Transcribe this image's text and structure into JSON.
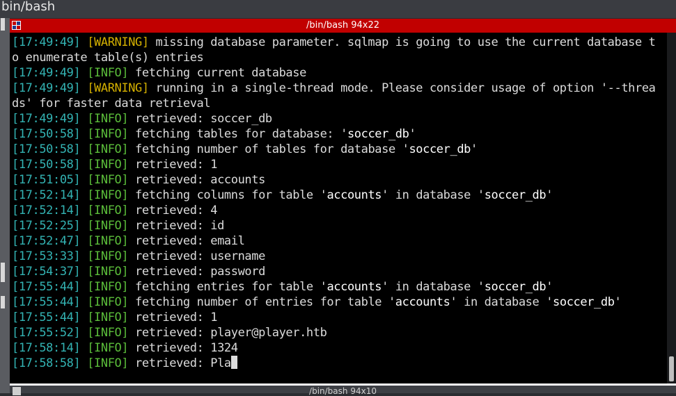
{
  "window": {
    "title": "bin/bash"
  },
  "pane": {
    "title": "/bin/bash 94x22"
  },
  "bottom_pane": {
    "title": "/bin/bash 94x10"
  },
  "terminal": {
    "lines": [
      {
        "ts": "[17:49:49]",
        "level": "[WARNING]",
        "level_kind": "warn",
        "text": " missing database parameter. sqlmap is going to use the current database t"
      },
      {
        "ts": "",
        "level": "",
        "level_kind": "none",
        "text": "o enumerate table(s) entries"
      },
      {
        "ts": "[17:49:49]",
        "level": "[INFO]",
        "level_kind": "info",
        "text": " fetching current database"
      },
      {
        "ts": "[17:49:49]",
        "level": "[WARNING]",
        "level_kind": "warn",
        "text": " running in a single-thread mode. Please consider usage of option '--threa"
      },
      {
        "ts": "",
        "level": "",
        "level_kind": "none",
        "text": "ds' for faster data retrieval"
      },
      {
        "ts": "[17:49:49]",
        "level": "[INFO]",
        "level_kind": "info",
        "text": " retrieved: soccer_db"
      },
      {
        "ts": "[17:50:58]",
        "level": "[INFO]",
        "level_kind": "info",
        "text": " fetching tables for database: 'soccer_db'"
      },
      {
        "ts": "[17:50:58]",
        "level": "[INFO]",
        "level_kind": "info",
        "text": " fetching number of tables for database 'soccer_db'"
      },
      {
        "ts": "[17:50:58]",
        "level": "[INFO]",
        "level_kind": "info",
        "text": " retrieved: 1"
      },
      {
        "ts": "[17:51:05]",
        "level": "[INFO]",
        "level_kind": "info",
        "text": " retrieved: accounts"
      },
      {
        "ts": "[17:52:14]",
        "level": "[INFO]",
        "level_kind": "info",
        "text": " fetching columns for table 'accounts' in database 'soccer_db'"
      },
      {
        "ts": "[17:52:14]",
        "level": "[INFO]",
        "level_kind": "info",
        "text": " retrieved: 4"
      },
      {
        "ts": "[17:52:25]",
        "level": "[INFO]",
        "level_kind": "info",
        "text": " retrieved: id"
      },
      {
        "ts": "[17:52:47]",
        "level": "[INFO]",
        "level_kind": "info",
        "text": " retrieved: email"
      },
      {
        "ts": "[17:53:33]",
        "level": "[INFO]",
        "level_kind": "info",
        "text": " retrieved: username"
      },
      {
        "ts": "[17:54:37]",
        "level": "[INFO]",
        "level_kind": "info",
        "text": " retrieved: password"
      },
      {
        "ts": "[17:55:44]",
        "level": "[INFO]",
        "level_kind": "info",
        "text": " fetching entries for table 'accounts' in database 'soccer_db'"
      },
      {
        "ts": "[17:55:44]",
        "level": "[INFO]",
        "level_kind": "info",
        "text": " fetching number of entries for table 'accounts' in database 'soccer_db'"
      },
      {
        "ts": "[17:55:44]",
        "level": "[INFO]",
        "level_kind": "info",
        "text": " retrieved: 1"
      },
      {
        "ts": "[17:55:52]",
        "level": "[INFO]",
        "level_kind": "info",
        "text": " retrieved: player@player.htb"
      },
      {
        "ts": "[17:58:14]",
        "level": "[INFO]",
        "level_kind": "info",
        "text": " retrieved: 1324"
      },
      {
        "ts": "[17:58:58]",
        "level": "[INFO]",
        "level_kind": "info",
        "text": " retrieved: Pla"
      }
    ]
  },
  "colors": {
    "timestamp": "#33b3b3",
    "warning": "#d4b000",
    "info": "#5bbd3a",
    "pane_title_bg": "#c10000"
  }
}
